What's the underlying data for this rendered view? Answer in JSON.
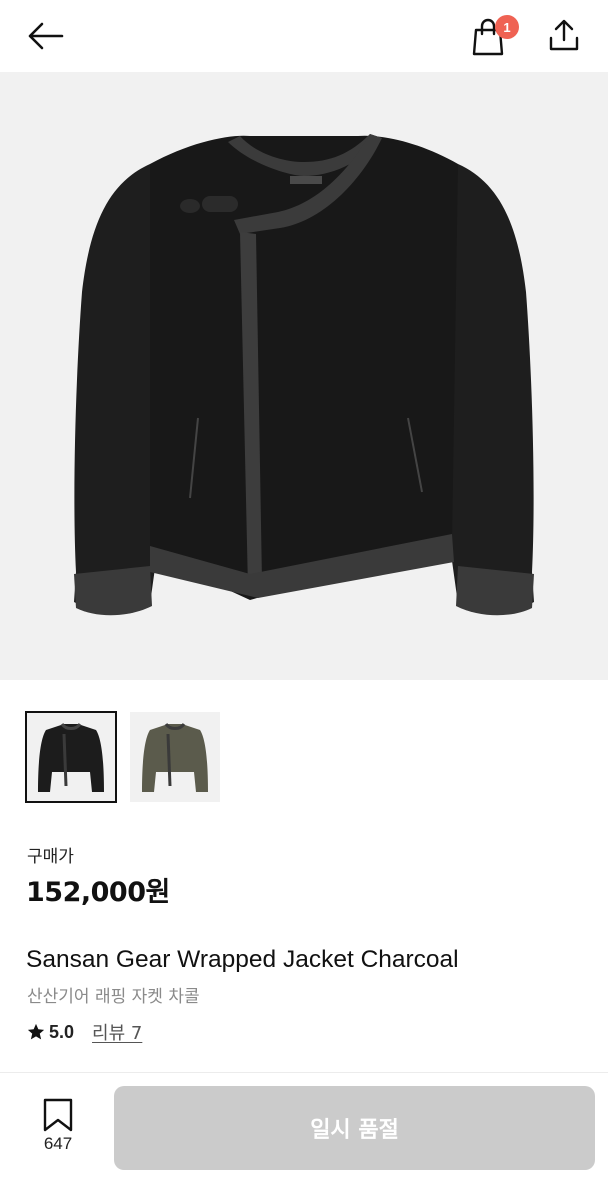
{
  "header": {
    "back_icon": "arrow-left-icon",
    "cart_icon": "shopping-bag-icon",
    "cart_badge_count": "1",
    "share_icon": "share-icon",
    "badge_color": "#ef6253"
  },
  "gallery": {
    "main_image": "charcoal-wrapped-jacket-photo",
    "thumbnails": [
      {
        "name": "charcoal-jacket-thumbnail",
        "selected": true
      },
      {
        "name": "olive-jacket-thumbnail",
        "selected": false
      }
    ]
  },
  "product": {
    "price_label": "구매가",
    "price": "152,000원",
    "title_en": "Sansan Gear Wrapped Jacket Charcoal",
    "title_ko": "산산기어 래핑 자켓 차콜",
    "rating": "5.0",
    "review_link": "리뷰 7"
  },
  "footer": {
    "wishlist_icon": "bookmark-icon",
    "wishlist_count": "647",
    "action_label": "일시 품절",
    "action_color": "#cbcbcb"
  }
}
